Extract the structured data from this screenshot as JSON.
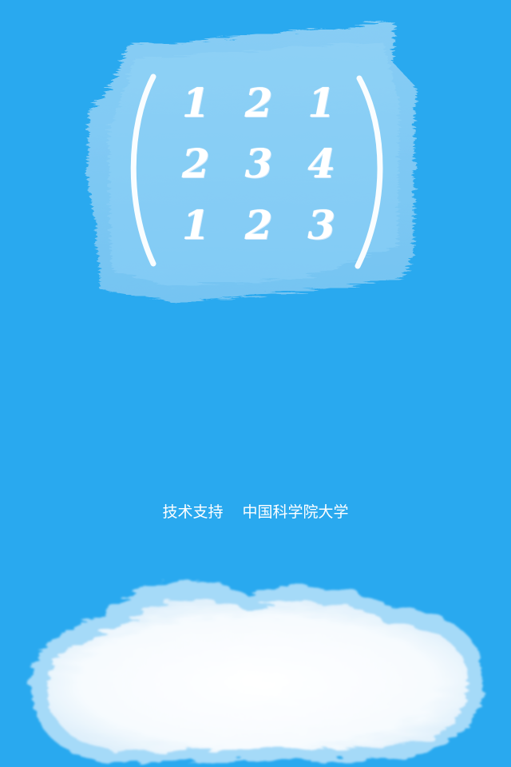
{
  "matrix": {
    "rows": [
      [
        "1",
        "2",
        "1"
      ],
      [
        "2",
        "3",
        "4"
      ],
      [
        "1",
        "2",
        "3"
      ]
    ]
  },
  "credit": {
    "label": "技术支持",
    "organization": "中国科学院大学"
  },
  "colors": {
    "background": "#29a9ef",
    "panel": "#7fc8f3",
    "chalk": "#ffffff"
  },
  "icons": {
    "cloud": "cloud-icon"
  }
}
